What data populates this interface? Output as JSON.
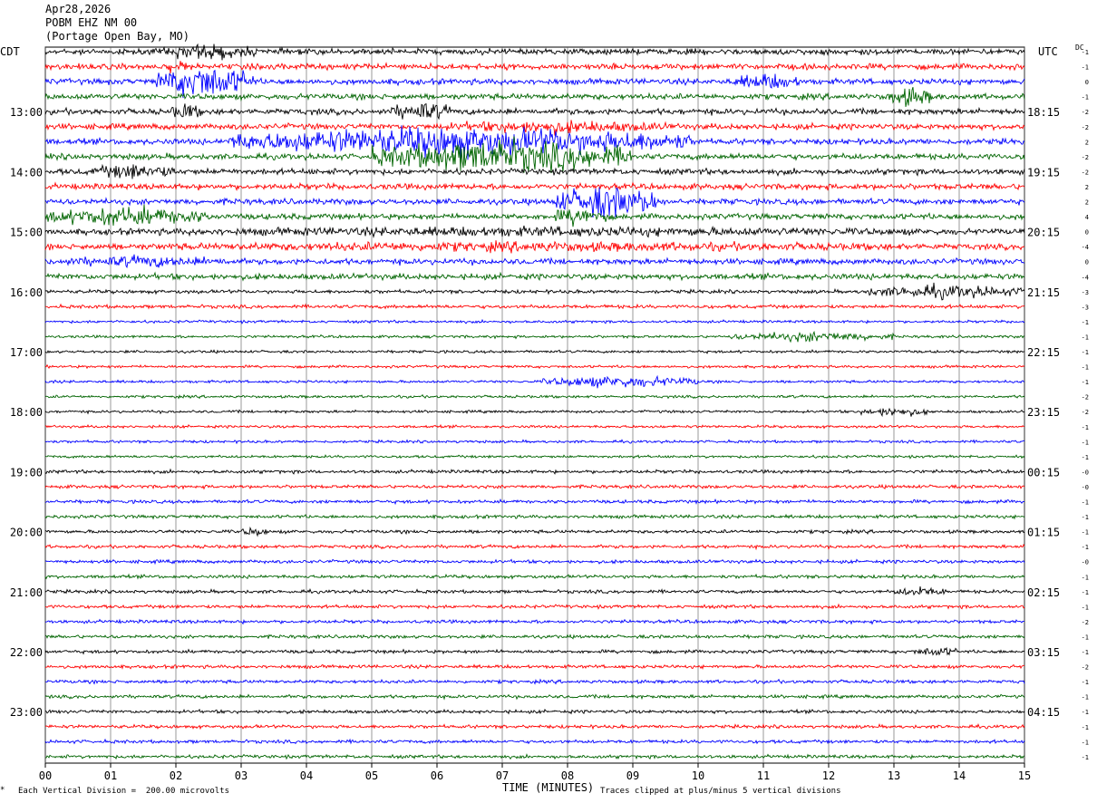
{
  "header": {
    "date": "Apr28,2026",
    "station": "POBM EHZ NM 00",
    "location": "(Portage Open Bay, MO)"
  },
  "tz": {
    "left": "CDT",
    "right": "UTC",
    "dc": "DC"
  },
  "footer": {
    "scale_note": "Each Vertical Division =  200.00 microvolts",
    "xlabel": "TIME (MINUTES)",
    "clip_note": "Traces clipped at plus/minus 5 vertical divisions"
  },
  "chart_data": {
    "type": "line",
    "title": "POBM EHZ NM 00",
    "xlabel": "TIME (MINUTES)",
    "xlim": [
      0,
      15
    ],
    "x_ticks": [
      "00",
      "01",
      "02",
      "03",
      "04",
      "05",
      "06",
      "07",
      "08",
      "09",
      "10",
      "11",
      "12",
      "13",
      "14",
      "15"
    ],
    "rows": 48,
    "row_minutes": 15,
    "trace_colors": [
      "#000000",
      "#ff0000",
      "#0000ff",
      "#006400"
    ],
    "cdt_labels": [
      "13:00",
      "14:00",
      "15:00",
      "16:00",
      "17:00",
      "18:00",
      "19:00",
      "20:00",
      "21:00",
      "22:00",
      "23:00"
    ],
    "utc_labels": [
      "18:15",
      "19:15",
      "20:15",
      "21:15",
      "22:15",
      "23:15",
      "00:15",
      "01:15",
      "02:15",
      "03:15",
      "04:15"
    ],
    "dc_offsets": [
      "-1",
      "-1",
      "0",
      "-1",
      "-2",
      "-2",
      "2",
      "-2",
      "-2",
      "2",
      "2",
      "4",
      "0",
      "-4",
      "0",
      "-4",
      "-3",
      "-3",
      "-1",
      "-1",
      "-1",
      "-1",
      "-1",
      "-2",
      "-2",
      "-1",
      "-1",
      "-1",
      "-0",
      "-0",
      "-1",
      "-1",
      "-1",
      "-1",
      "-0",
      "-1",
      "-1",
      "-1",
      "-2",
      "-1",
      "-1",
      "-2",
      "-1",
      "-1",
      "-1",
      "-1",
      "-1",
      "-1"
    ],
    "activity": [
      {
        "row": 0,
        "start": 1.8,
        "end": 3.2,
        "amp": 2.5
      },
      {
        "row": 1,
        "start": 1.8,
        "end": 2.2,
        "amp": 2
      },
      {
        "row": 2,
        "start": 1.7,
        "end": 3.2,
        "amp": 5
      },
      {
        "row": 2,
        "start": 10.5,
        "end": 11.6,
        "amp": 2.5
      },
      {
        "row": 3,
        "start": 12.9,
        "end": 13.6,
        "amp": 3
      },
      {
        "row": 4,
        "start": 1.9,
        "end": 2.4,
        "amp": 2.5
      },
      {
        "row": 4,
        "start": 5.3,
        "end": 6.2,
        "amp": 3
      },
      {
        "row": 5,
        "start": 6,
        "end": 9.6,
        "amp": 2
      },
      {
        "row": 6,
        "start": 2.8,
        "end": 9.9,
        "amp": 4.5
      },
      {
        "row": 7,
        "start": 5,
        "end": 9,
        "amp": 5
      },
      {
        "row": 8,
        "start": 0.7,
        "end": 2,
        "amp": 2.5
      },
      {
        "row": 10,
        "start": 7.8,
        "end": 9.4,
        "amp": 5
      },
      {
        "row": 11,
        "start": 0,
        "end": 2.5,
        "amp": 3
      },
      {
        "row": 11,
        "start": 7.8,
        "end": 8.6,
        "amp": 3
      },
      {
        "row": 12,
        "start": 0,
        "end": 15,
        "amp": 1.5
      },
      {
        "row": 13,
        "start": 0,
        "end": 15,
        "amp": 1.5
      },
      {
        "row": 14,
        "start": 0,
        "end": 3,
        "amp": 1.8
      },
      {
        "row": 16,
        "start": 12.5,
        "end": 15,
        "amp": 2
      },
      {
        "row": 19,
        "start": 10.5,
        "end": 13,
        "amp": 1.5
      },
      {
        "row": 22,
        "start": 7.6,
        "end": 10,
        "amp": 1.8
      },
      {
        "row": 24,
        "start": 12.5,
        "end": 13.5,
        "amp": 1.5
      },
      {
        "row": 32,
        "start": 3,
        "end": 3.4,
        "amp": 1.5
      },
      {
        "row": 36,
        "start": 13,
        "end": 13.8,
        "amp": 1.5
      },
      {
        "row": 40,
        "start": 13.3,
        "end": 14,
        "amp": 1.5
      }
    ]
  }
}
